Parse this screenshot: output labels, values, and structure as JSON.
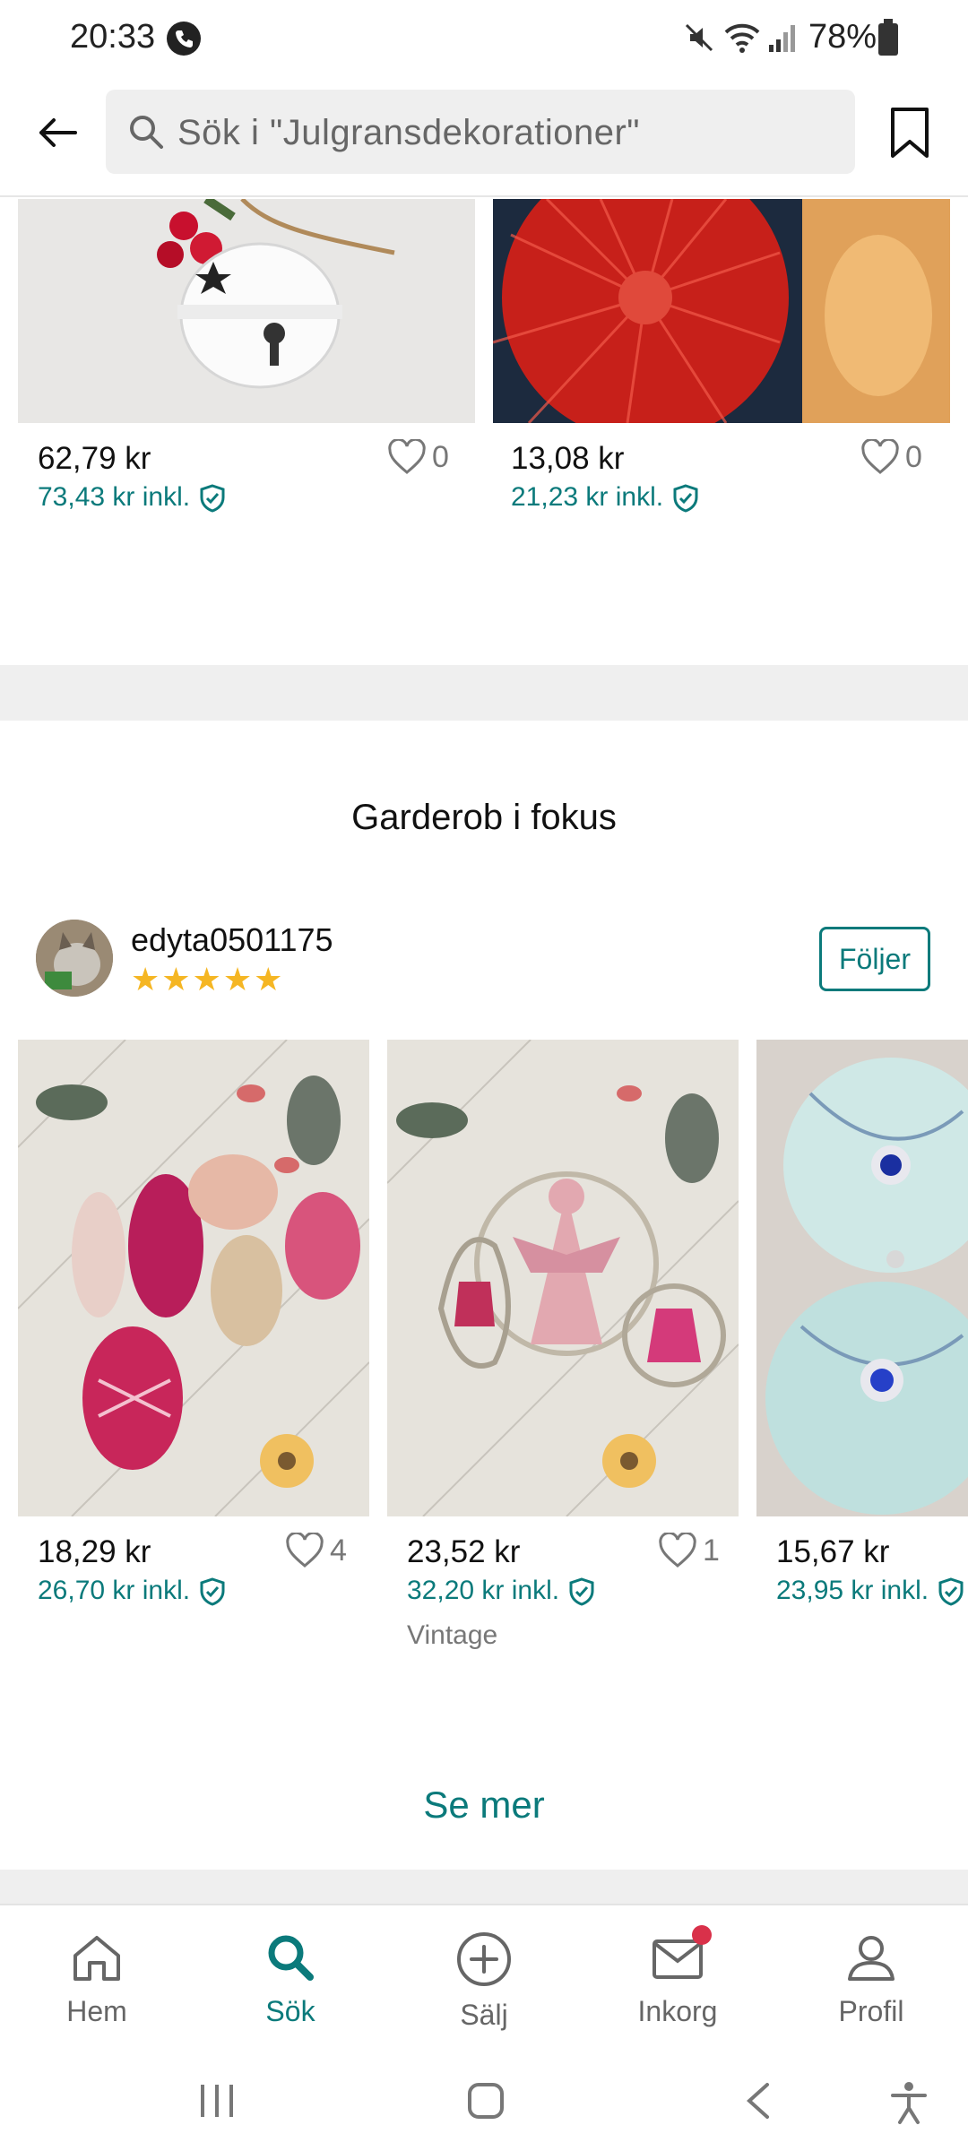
{
  "status_bar": {
    "time": "20:33",
    "battery": "78%"
  },
  "header": {
    "search_text": "Sök i \"Julgransdekorationer\""
  },
  "top_products": [
    {
      "price": "62,79 kr",
      "price_incl": "73,43 kr inkl.",
      "likes": "0"
    },
    {
      "price": "13,08 kr",
      "price_incl": "21,23 kr inkl.",
      "likes": "0"
    }
  ],
  "focus": {
    "title": "Garderob i fokus",
    "seller": "edyta0501175",
    "stars": "★★★★★",
    "follow_label": "Följer",
    "items": [
      {
        "price": "18,29 kr",
        "price_incl": "26,70 kr inkl.",
        "likes": "4",
        "tag": ""
      },
      {
        "price": "23,52 kr",
        "price_incl": "32,20 kr inkl.",
        "likes": "1",
        "tag": "Vintage"
      },
      {
        "price": "15,67 kr",
        "price_incl": "23,95 kr inkl.",
        "likes": "",
        "tag": ""
      }
    ],
    "see_more": "Se mer"
  },
  "bottom_nav": {
    "items": [
      {
        "label": "Hem",
        "icon": "home-icon"
      },
      {
        "label": "Sök",
        "icon": "search-icon",
        "active": true
      },
      {
        "label": "Sälj",
        "icon": "plus-circle-icon"
      },
      {
        "label": "Inkorg",
        "icon": "mail-icon"
      },
      {
        "label": "Profil",
        "icon": "profile-icon"
      }
    ]
  },
  "colors": {
    "accent": "#0b7a7b",
    "star": "#f5b623",
    "band": "#efefef",
    "badge": "#d9314a"
  }
}
